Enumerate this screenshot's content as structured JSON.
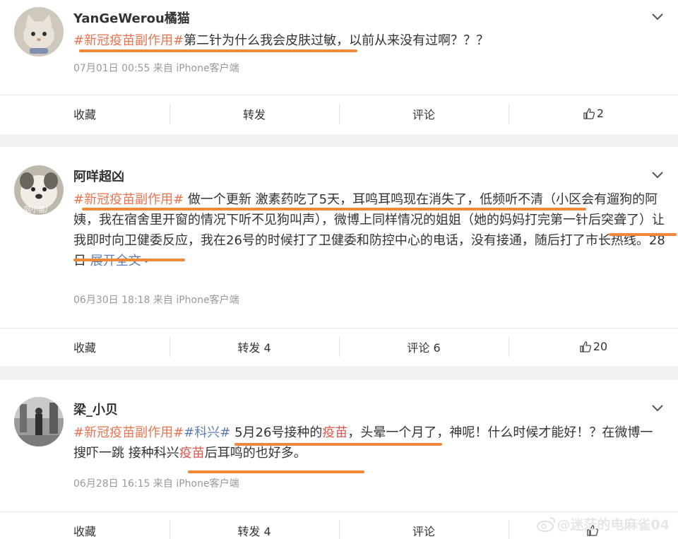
{
  "posts": [
    {
      "username": "YanGeWerou橘猫",
      "text": [
        {
          "t": "#新冠疫苗副作用#",
          "c": "tag"
        },
        {
          "t": "第二针为什么我会皮肤过敏，以前从来没有过啊？？？",
          "c": ""
        }
      ],
      "meta": "07月01日 00:55 来自 iPhone客户端",
      "actions": {
        "collect": "收藏",
        "repost": "转发",
        "comment": "评论",
        "like": "2"
      }
    },
    {
      "username": "阿咩超凶",
      "avatar_text": "同小苗/",
      "text": [
        {
          "t": "#新冠疫苗副作用#",
          "c": "tag"
        },
        {
          "t": " 做一个更新 激素药吃了5天，耳鸣耳鸣现在消失了，低频听不清（小区会有遛狗的阿姨，我在宿舍里开窗的情况下听不见狗叫声），微博上同样情况的姐姐（她的妈妈打完第一针后突聋了）让我即时向卫健委反应，我在26号的时候打了卫健委和防控中心的电话，没有接通，随后打了市长热线。28日 ",
          "c": ""
        },
        {
          "t": "展开全文",
          "c": "link"
        }
      ],
      "meta": "06月30日 18:18 来自 iPhone客户端",
      "actions": {
        "collect": "收藏",
        "repost": "转发 4",
        "comment": "评论 6",
        "like": "20"
      }
    },
    {
      "username": "梁_小贝",
      "text": [
        {
          "t": "#新冠疫苗副作用#",
          "c": "tag"
        },
        {
          "t": "#科兴#",
          "c": "tag-blue"
        },
        {
          "t": " 5月26号接种的",
          "c": ""
        },
        {
          "t": "疫苗",
          "c": "hl"
        },
        {
          "t": "，头晕一个月了，神呢！什么时候才能好！？在微博一搜吓一跳 接种科兴",
          "c": ""
        },
        {
          "t": "疫苗",
          "c": "hl"
        },
        {
          "t": "后耳鸣的也好多。",
          "c": ""
        }
      ],
      "meta": "06月28日 16:15 来自 iPhone客户端",
      "actions": {
        "collect": "收藏",
        "repost": "转发 4",
        "comment": "评论",
        "like": ""
      }
    }
  ],
  "watermark": "@迷茫的电麻雀04",
  "colors": {
    "tag": "#eb7350",
    "link": "#5d7eb4",
    "underline": "#f08a3a"
  }
}
